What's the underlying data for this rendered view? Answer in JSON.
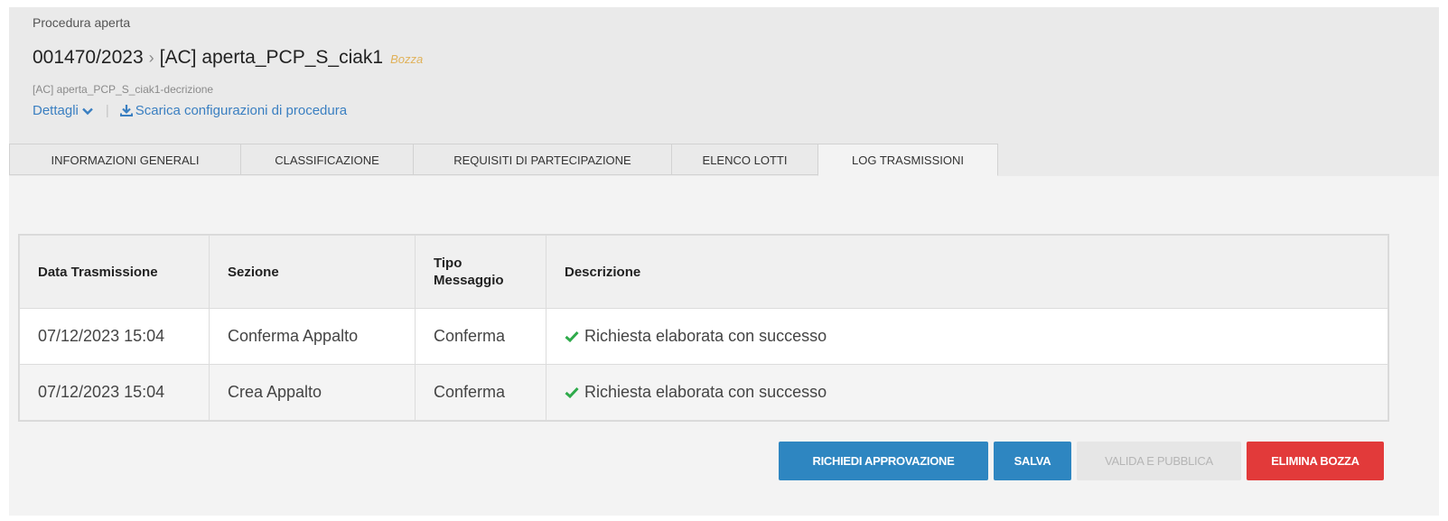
{
  "header": {
    "procedure_type": "Procedura aperta",
    "code": "001470/2023",
    "separator": "›",
    "name": "[AC] aperta_PCP_S_ciak1",
    "status": "Bozza",
    "description": "[AC] aperta_PCP_S_ciak1-decrizione",
    "details_label": "Dettagli",
    "download_label": "Scarica configurazioni di procedura",
    "colors": {
      "link": "#3a7fc1",
      "status": "#e0b25a"
    }
  },
  "tabs": [
    {
      "label": "INFORMAZIONI GENERALI",
      "active": false
    },
    {
      "label": "CLASSIFICAZIONE",
      "active": false
    },
    {
      "label": "REQUISITI DI PARTECIPAZIONE",
      "active": false
    },
    {
      "label": "ELENCO LOTTI",
      "active": false
    },
    {
      "label": "LOG TRASMISSIONI",
      "active": true
    }
  ],
  "table": {
    "headers": {
      "date": "Data Trasmissione",
      "section": "Sezione",
      "type_line1": "Tipo",
      "type_line2": "Messaggio",
      "description": "Descrizione"
    },
    "rows": [
      {
        "date": "07/12/2023 15:04",
        "section": "Conferma Appalto",
        "type": "Conferma",
        "icon": "check-icon",
        "description": "Richiesta elaborata con successo"
      },
      {
        "date": "07/12/2023 15:04",
        "section": "Crea Appalto",
        "type": "Conferma",
        "icon": "check-icon",
        "description": "Richiesta elaborata con successo"
      }
    ],
    "colors": {
      "success": "#2eaa4a"
    }
  },
  "actions": {
    "request_approval": "RICHIEDI APPROVAZIONE",
    "save": "SALVA",
    "validate_publish": "VALIDA E PUBBLICA",
    "delete_draft": "ELIMINA BOZZA",
    "colors": {
      "primary": "#2e86c1",
      "danger": "#e23a3a",
      "disabled": "#e6e6e6"
    }
  }
}
